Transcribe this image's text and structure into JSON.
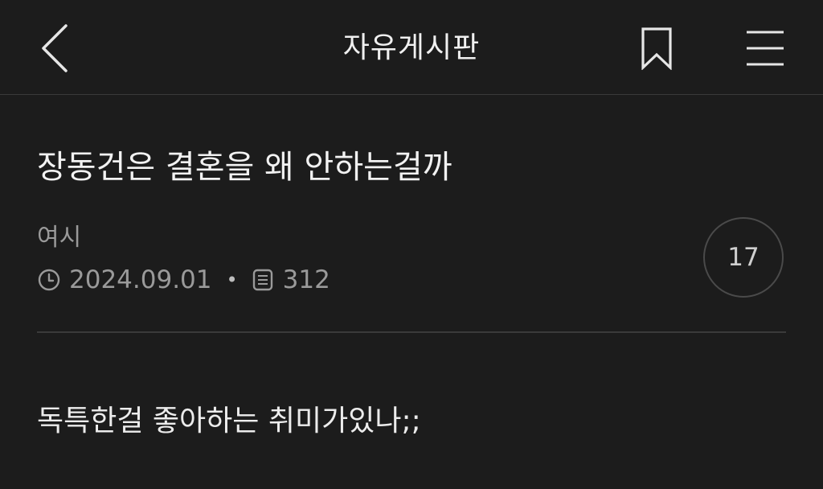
{
  "header": {
    "title": "자유게시판",
    "icons": {
      "back": "chevron-left-icon",
      "bookmark": "bookmark-icon",
      "menu": "hamburger-menu-icon"
    }
  },
  "post": {
    "title": "장동건은 결혼을 왜 안하는걸까",
    "author": "여시",
    "date": "2024.09.01",
    "views": "312",
    "comment_count": "17",
    "body": "독특한걸 좋아하는 취미가있나;;"
  },
  "colors": {
    "background": "#1c1c1c",
    "text_primary": "#f2f2f2",
    "text_secondary": "#9a9a9a",
    "divider": "#3a3a3a"
  }
}
